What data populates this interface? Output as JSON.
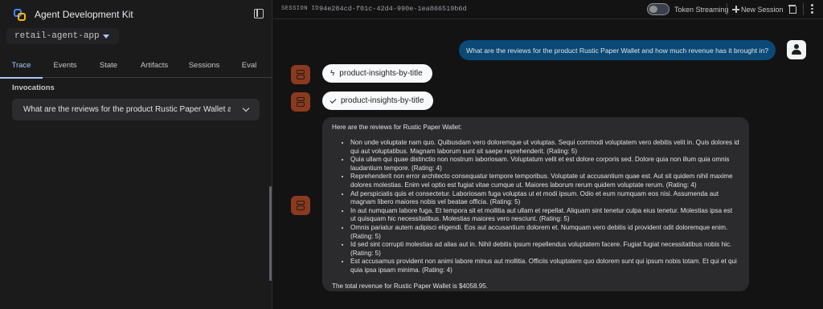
{
  "sidebar": {
    "title": "Agent Development Kit",
    "app_select": "retail-agent-app",
    "tabs": [
      {
        "label": "Trace",
        "active": true
      },
      {
        "label": "Events"
      },
      {
        "label": "State"
      },
      {
        "label": "Artifacts"
      },
      {
        "label": "Sessions"
      },
      {
        "label": "Eval"
      }
    ],
    "invocations_label": "Invocations",
    "invocation_item": "What are the reviews for the product Rustic Paper Wallet and how much revenue has it brought in?"
  },
  "topbar": {
    "session_label": "SESSION ID",
    "session_id": "94e284cd-f01c-42d4-990e-1ea866519b6d",
    "token_streaming_label": "Token Streaming",
    "token_streaming_on": false,
    "new_session_label": "New Session"
  },
  "chat": {
    "user_message": "What are the reviews for the product Rustic Paper Wallet and how much revenue has it brought in?",
    "function_call": "product-insights-by-title",
    "function_response": "product-insights-by-title",
    "bot_intro": "Here are the reviews for Rustic Paper Wallet:",
    "reviews": [
      "Non unde voluptate nam quo. Quibusdam vero doloremque ut voluptas. Sequi commodi voluptatem vero debitis velit in. Quis dolores id qui aut voluptatibus. Magnam laborum sunt sit saepe reprehenderit. (Rating: 5)",
      "Quia ullam qui quae distinctio non nostrum laboriosam. Voluptatum velit et est dolore corporis sed. Dolore quia non illum quia omnis laudantium tempore. (Rating: 4)",
      "Reprehenderit non error architecto consequatur tempore temporibus. Voluptate ut accusantium quae est. Aut sit quidem nihil maxime dolores molestias. Enim vel optio est fugiat vitae cumque ut. Maiores laborum rerum quidem voluptate rerum. (Rating: 4)",
      "Ad perspiciatis quis et consectetur. Laboriosam fuga voluptas ut et modi ipsum. Odio et eum numquam eos nisi. Assumenda aut magnam libero maiores nobis vel beatae officia. (Rating: 5)",
      "In aut numquam labore fuga. Et tempora sit et mollitia aut ullam et repellat. Aliquam sint tenetur culpa eius tenetur. Molestias ipsa est ut quisquam hic necessitatibus. Molestias maiores vero nesciunt. (Rating: 5)",
      "Omnis pariatur autem adipisci eligendi. Eos aut accusantium dolorem et. Numquam vero debitis id provident odit doloremque enim. (Rating: 5)",
      "Id sed sint corrupti molestias ad alias aut in. Nihil debitis ipsum repellendus voluptatem facere. Fugiat fugiat necessitatibus nobis hic. (Rating: 5)",
      "Est accusamus provident non animi labore minus aut mollitia. Officiis voluptatem quo dolorem sunt qui ipsum nobis totam. Et qui et qui quia ipsa ipsam minima. (Rating: 4)"
    ],
    "bot_total": "The total revenue for Rustic Paper Wallet is $4058.95."
  },
  "icons": {
    "brand": "adk-logo-icon",
    "collapse": "panel-collapse-icon",
    "new_session": "plus-icon",
    "delete": "trash-icon",
    "more": "more-vert-icon",
    "user": "person-icon",
    "bot": "robot-icon",
    "call": "bolt-icon",
    "response": "check-icon"
  },
  "colors": {
    "accent": "#a8c7fa",
    "user_bubble": "#0b4a77",
    "bot_avatar": "#8b3a1f"
  }
}
